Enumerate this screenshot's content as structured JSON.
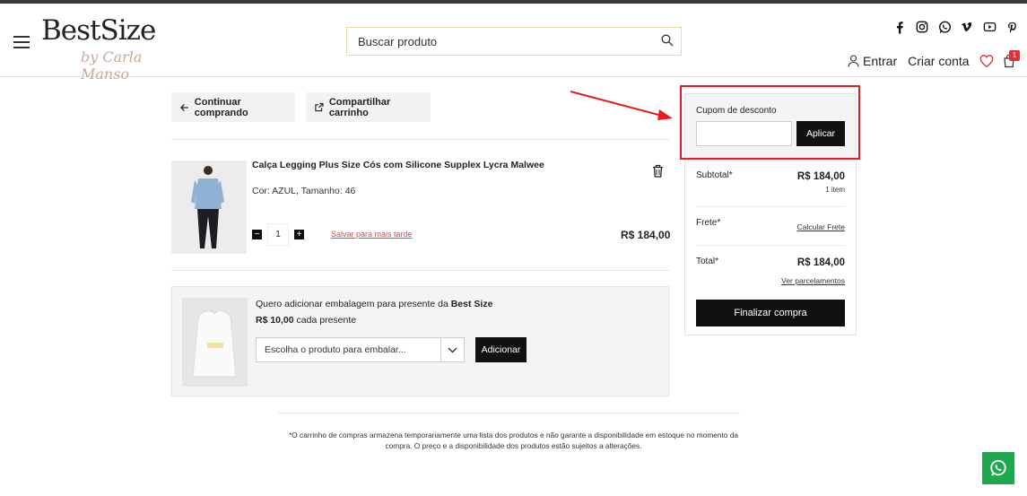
{
  "header": {
    "logo_main": "BestSize",
    "logo_sub": "by Carla Manso",
    "search_placeholder": "Buscar produto",
    "socials": [
      "facebook-icon",
      "instagram-icon",
      "whatsapp-icon",
      "vimeo-icon",
      "youtube-icon",
      "pinterest-icon"
    ],
    "login_label": "Entrar",
    "create_account_label": "Criar conta",
    "cart_count": "1"
  },
  "cart": {
    "continue_label": "Continuar comprando",
    "share_label": "Compartilhar carrinho",
    "item": {
      "name": "Calça Legging Plus Size Cós com Silicone Supplex Lycra Malwee",
      "variant": "Cor: AZUL, Tamanho: 46",
      "quantity": "1",
      "save_later": "Salvar para mais tarde",
      "price": "R$ 184,00"
    },
    "gift": {
      "text_prefix": "Quero adicionar embalagem para presente da ",
      "brand": "Best Size",
      "price": "R$ 10,00",
      "price_suffix": " cada presente",
      "select_placeholder": "Escolha o produto para embalar...",
      "add_label": "Adicionar"
    },
    "disclaimer": "*O carrinho de compras armazena temporariamente uma lista dos produtos e não garante a disponibilidade em estoque no momento da compra. O preço e a disponibilidade dos produtos estão sujeitos a alterações."
  },
  "summary": {
    "coupon_label": "Cupom de desconto",
    "coupon_value": "",
    "apply_label": "Aplicar",
    "subtotal_label": "Subtotal*",
    "subtotal_value": "R$ 184,00",
    "subtotal_items": "1 item",
    "shipping_label": "Frete*",
    "shipping_link": "Calcular Frete",
    "total_label": "Total*",
    "total_value": "R$ 184,00",
    "installments_link": "Ver parcelamentos",
    "checkout_label": "Finalizar compra"
  },
  "colors": {
    "accent_red": "#e51c23",
    "dark_button": "#111111",
    "whatsapp_green": "#1ea94e"
  }
}
